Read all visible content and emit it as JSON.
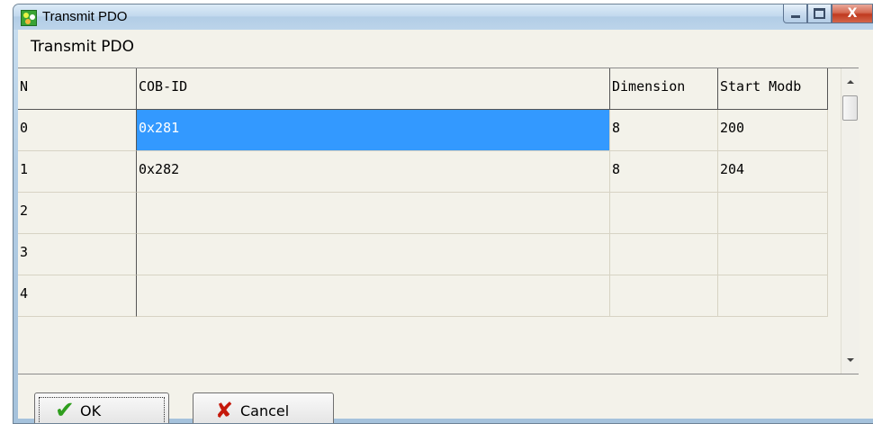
{
  "window": {
    "title": "Transmit PDO",
    "close_glyph": "X"
  },
  "dialog": {
    "heading": "Transmit PDO"
  },
  "table": {
    "headers": [
      "N",
      "COB-ID",
      "Dimension",
      "Start Modb"
    ],
    "rows": [
      [
        "0",
        "0x281",
        "8",
        "200"
      ],
      [
        "1",
        "0x282",
        "8",
        "204"
      ],
      [
        "2",
        "",
        "",
        ""
      ],
      [
        "3",
        "",
        "",
        ""
      ],
      [
        "4",
        "",
        "",
        ""
      ]
    ],
    "selected": {
      "row": 0,
      "column": 1
    }
  },
  "buttons": {
    "ok_label": "OK",
    "ok_icon": "check-icon",
    "cancel_label": "Cancel",
    "cancel_icon": "cross-icon"
  },
  "colors": {
    "selection": "#3399ff",
    "check": "#2f9e1e",
    "cross": "#c5190b"
  }
}
